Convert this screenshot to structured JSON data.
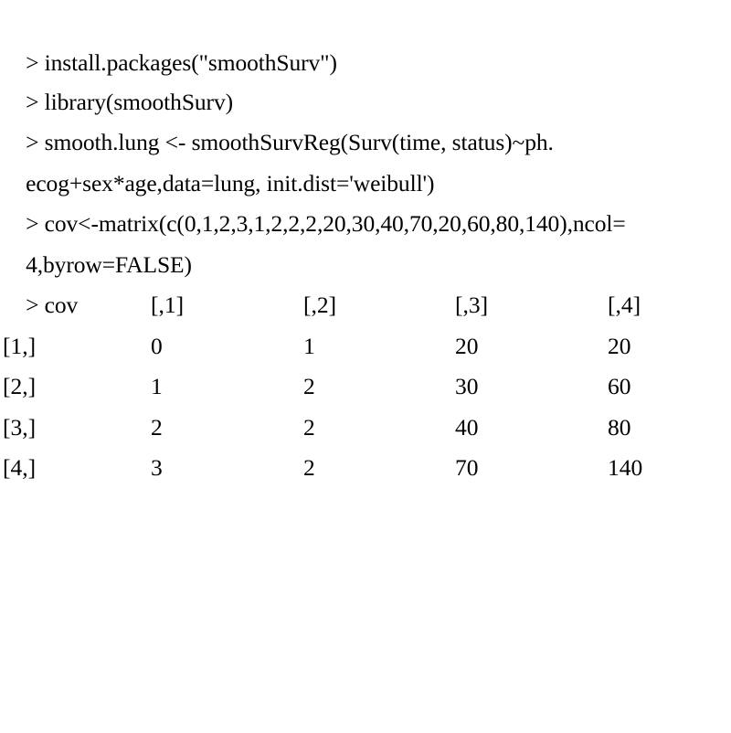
{
  "console": {
    "prompt": ">",
    "background_color": "#ffffff",
    "text_color": "#000000",
    "lines": [
      {
        "id": "line-1",
        "text": "> install.packages(\"smoothSurv\")"
      },
      {
        "id": "line-2",
        "text": "> library(smoothSurv)"
      },
      {
        "id": "line-3",
        "text": "> smooth.lung <- smoothSurvReg(Surv(time, status)~ph."
      },
      {
        "id": "line-4",
        "text": "ecog+sex*age,data=lung, init.dist='weibull')"
      },
      {
        "id": "line-5",
        "text": "> cov<-matrix(c(0,1,2,3,1,2,2,2,20,30,40,70,20,60,80,140),ncol="
      },
      {
        "id": "line-6",
        "text": "4,byrow=FALSE)"
      },
      {
        "id": "line-7",
        "text": "> cov"
      }
    ]
  },
  "matrix_output": {
    "column_headers": [
      "[,1]",
      "[,2]",
      "[,3]",
      "[,4]"
    ],
    "row_labels": [
      "[1,]",
      "[2,]",
      "[3,]",
      "[4,]"
    ],
    "rows": [
      [
        "0",
        "1",
        "20",
        "20"
      ],
      [
        "1",
        "2",
        "30",
        "60"
      ],
      [
        "2",
        "2",
        "40",
        "80"
      ],
      [
        "3",
        "2",
        "70",
        "140"
      ]
    ]
  },
  "chart_data": {
    "type": "table",
    "title": "cov",
    "columns": [
      "",
      "[,1]",
      "[,2]",
      "[,3]",
      "[,4]"
    ],
    "rows": [
      [
        "[1,]",
        0,
        1,
        20,
        20
      ],
      [
        "[2,]",
        1,
        2,
        30,
        60
      ],
      [
        "[3,]",
        2,
        2,
        40,
        80
      ],
      [
        "[4,]",
        3,
        2,
        70,
        140
      ]
    ]
  }
}
